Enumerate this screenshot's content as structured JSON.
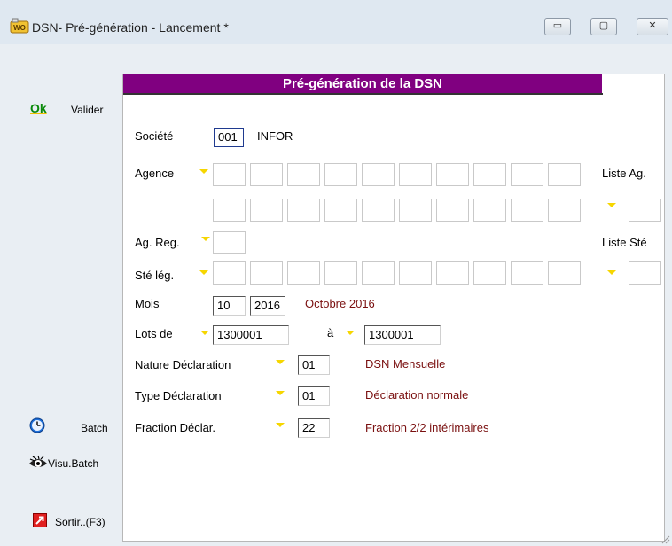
{
  "window": {
    "title": "DSN- Pré-génération - Lancement *",
    "controls": {
      "minimize": "▭",
      "maximize": "▢",
      "close": "✕"
    }
  },
  "toolbar": {
    "ok_icon": "Ok",
    "valider": "Valider",
    "batch": "Batch",
    "visu_batch": "Visu.Batch",
    "sortir": "Sortir..(F3)"
  },
  "form": {
    "title": "Pré-génération de la DSN",
    "societe_label": "Société",
    "societe_code": "001",
    "societe_name": "INFOR",
    "agence_label": "Agence",
    "liste_ag_label": "Liste Ag.",
    "ag_reg_label": "Ag. Reg.",
    "liste_ste_label": "Liste Sté",
    "ste_leg_label": "Sté lég.",
    "mois_label": "Mois",
    "mois_value": "10",
    "annee_value": "2016",
    "mois_text": "Octobre 2016",
    "lots_label": "Lots de",
    "lots_from": "1300001",
    "a_label": "à",
    "lots_to": "1300001",
    "nature_label": "Nature Déclaration",
    "nature_value": "01",
    "nature_text": "DSN Mensuelle",
    "type_label": "Type Déclaration",
    "type_value": "01",
    "type_text": "Déclaration normale",
    "fraction_label": "Fraction Déclar.",
    "fraction_value": "22",
    "fraction_text": "Fraction 2/2 intérimaires"
  },
  "colors": {
    "banner": "#800080",
    "accent_text": "#7a1010",
    "dropdown_marker": "#f6d600"
  },
  "icons": {
    "app": "wo-app-icon",
    "ok": "ok-icon",
    "batch": "clock-icon",
    "visu_batch": "eye-icon",
    "sortir": "exit-icon",
    "dropdown": "dropdown-marker-icon"
  }
}
